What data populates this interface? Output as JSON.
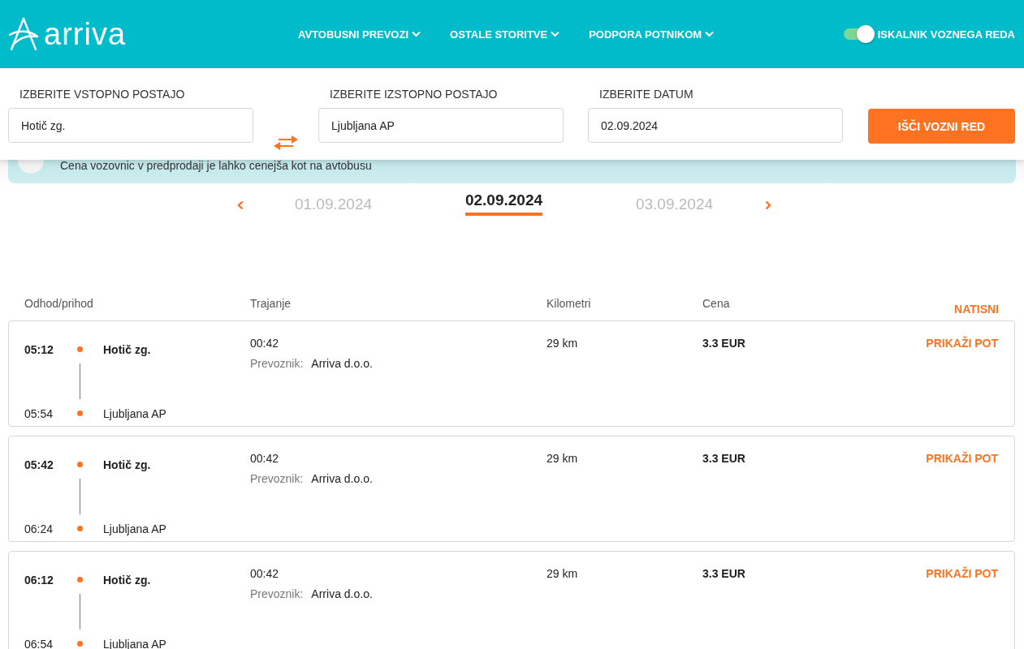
{
  "header": {
    "logo": "arriva",
    "nav": [
      {
        "label": "AVTOBUSNI PREVOZI"
      },
      {
        "label": "OSTALE STORITVE"
      },
      {
        "label": "PODPORA POTNIKOM"
      }
    ],
    "toggle": {
      "label": "ISKALNIK VOZNEGA REDA",
      "on": true
    }
  },
  "search": {
    "fields": [
      {
        "label": "IZBERITE VSTOPNO POSTAJO",
        "value": "Hotič zg."
      },
      {
        "label": "IZBERITE IZSTOPNO POSTAJO",
        "value": "Ljubljana AP"
      },
      {
        "label": "IZBERITE DATUM",
        "value": "02.09.2024"
      }
    ],
    "button": "IŠČI VOZNI RED"
  },
  "banner": {
    "text": "Cena vozovnic v predprodaji je lahko cenejša kot na avtobusu"
  },
  "dates": [
    {
      "label": "01.09.2024",
      "selected": false
    },
    {
      "label": "02.09.2024",
      "selected": true
    },
    {
      "label": "03.09.2024",
      "selected": false
    }
  ],
  "table": {
    "columns": [
      "Odhod/prihod",
      "Trajanje",
      "Kilometri",
      "Cena"
    ],
    "print": "NATISNI",
    "rows": [
      {
        "departure": "05:12",
        "from": "Hotič zg.",
        "arrival": "05:54",
        "to": "Ljubljana AP",
        "duration": "00:42",
        "carrier_label": "Prevoznik:",
        "carrier": "Arriva d.o.o.",
        "km": "29 km",
        "price": "3.3 EUR",
        "action": "PRIKAŽI POT"
      },
      {
        "departure": "05:42",
        "from": "Hotič zg.",
        "arrival": "06:24",
        "to": "Ljubljana AP",
        "duration": "00:42",
        "carrier_label": "Prevoznik:",
        "carrier": "Arriva d.o.o.",
        "km": "29 km",
        "price": "3.3 EUR",
        "action": "PRIKAŽI POT"
      },
      {
        "departure": "06:12",
        "from": "Hotič zg.",
        "arrival": "06:54",
        "to": "Ljubljana AP",
        "duration": "00:42",
        "carrier_label": "Prevoznik:",
        "carrier": "Arriva d.o.o.",
        "km": "29 km",
        "price": "3.3 EUR",
        "action": "PRIKAŽI POT"
      }
    ]
  }
}
